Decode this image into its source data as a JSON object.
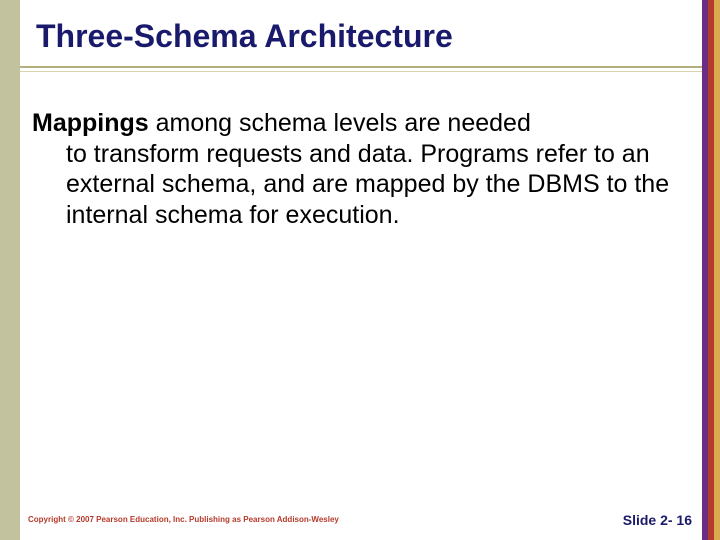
{
  "title": "Three-Schema Architecture",
  "body": {
    "lead": "Mappings",
    "line1_rest": " among schema levels are needed",
    "rest": "to transform requests and data. Programs refer to an external schema, and are mapped by the DBMS to the internal schema for execution."
  },
  "footer": {
    "copyright": "Copyright © 2007 Pearson Education, Inc. Publishing as Pearson Addison-Wesley",
    "slide_label": "Slide 2- 16"
  }
}
